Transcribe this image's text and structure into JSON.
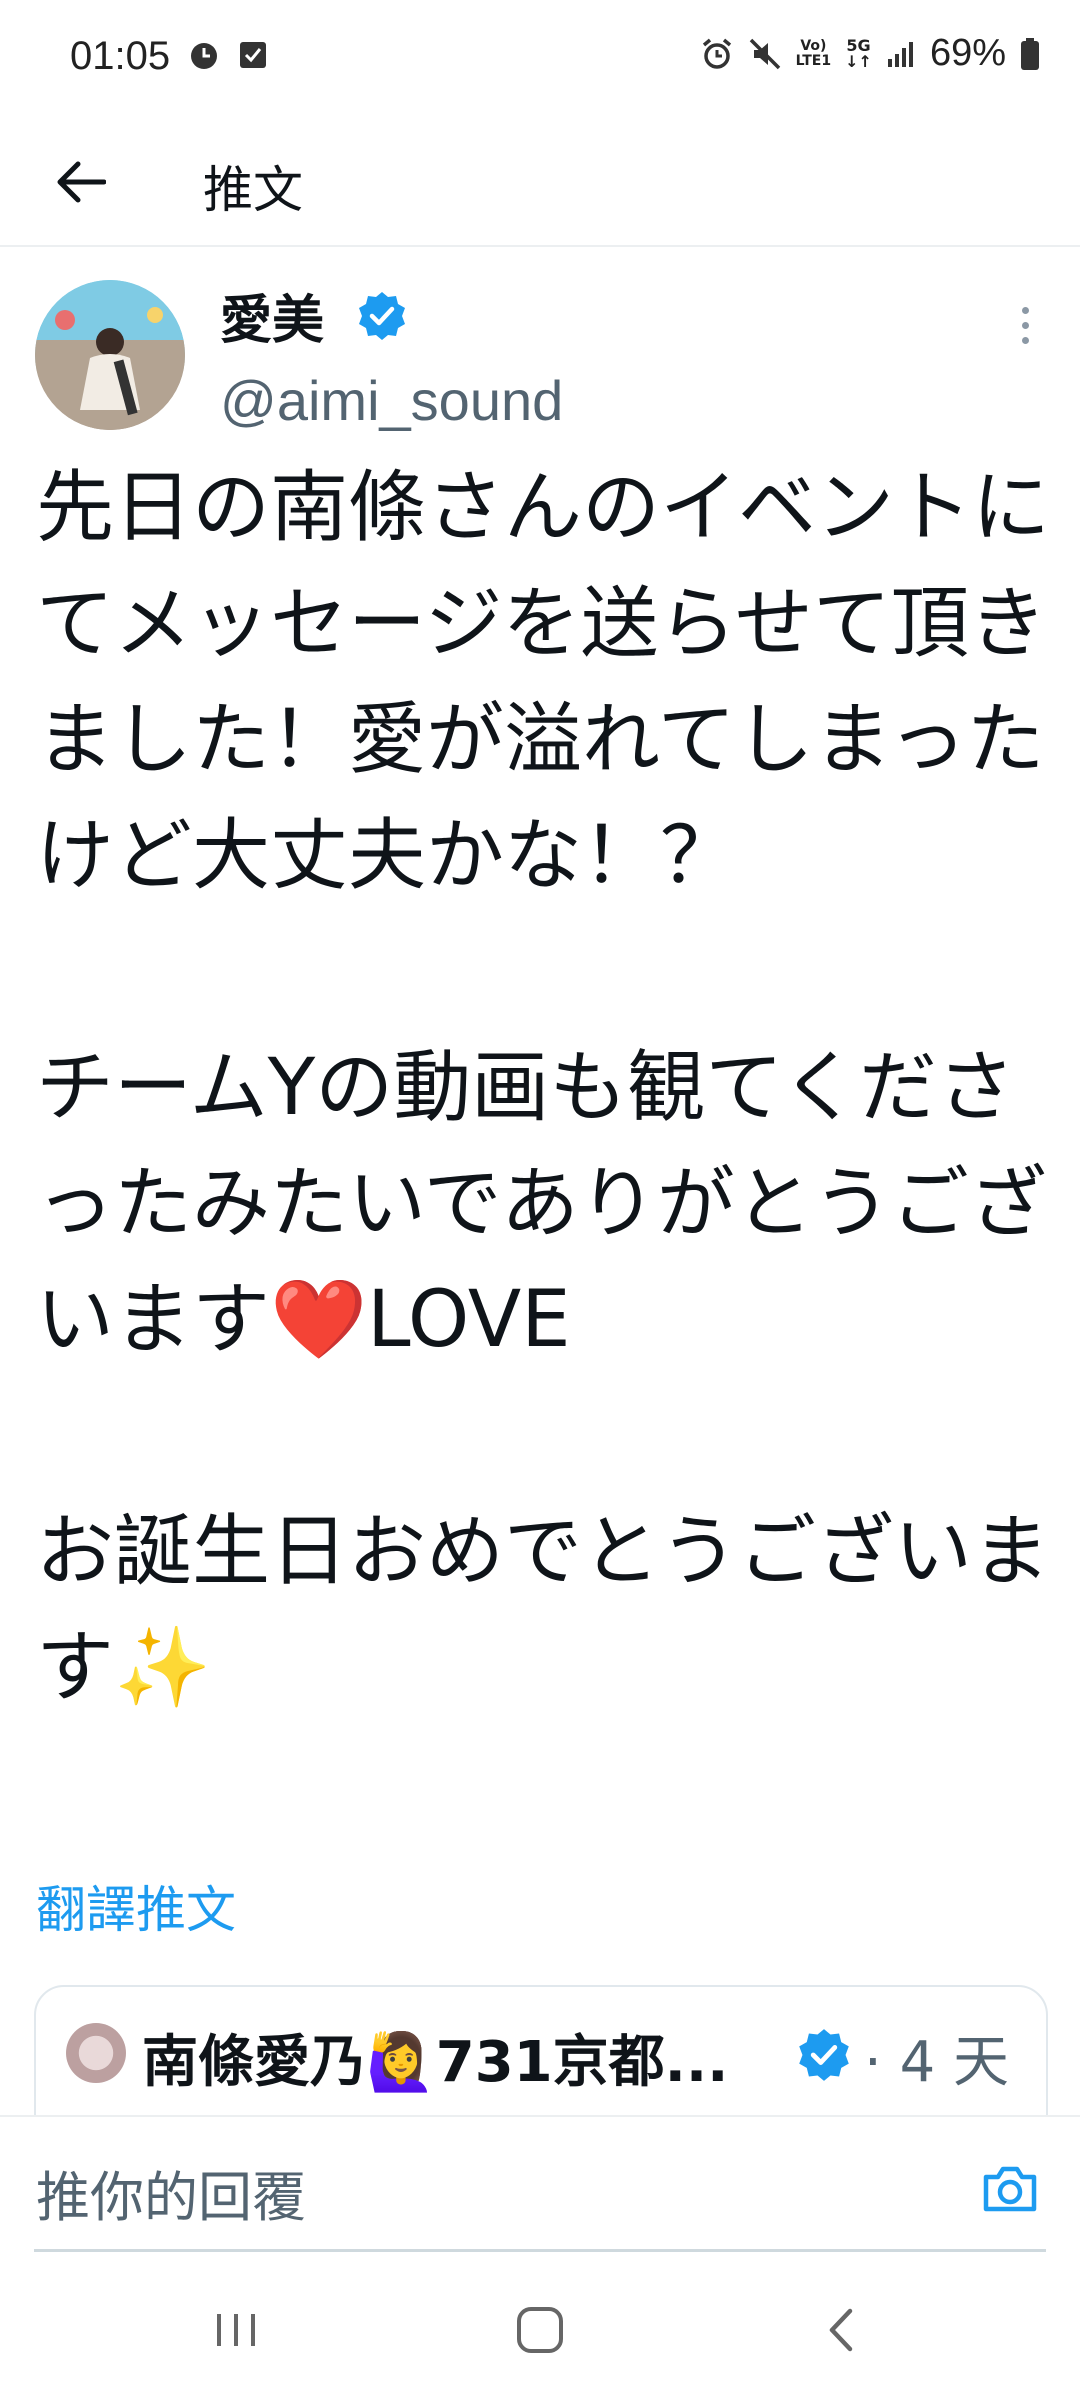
{
  "status_bar": {
    "time": "01:05",
    "battery": "69%",
    "network_volte": "Vo)\nLTE1",
    "network_5g": "5G",
    "icons": [
      "clock-icon",
      "checkbox-notification-icon",
      "alarm-icon",
      "mute-icon",
      "volte-icon",
      "5g-data-icon",
      "signal-icon",
      "battery-icon"
    ]
  },
  "header": {
    "title": "推文",
    "back_icon": "arrow-left-icon"
  },
  "tweet": {
    "author_name": "愛美",
    "handle": "@aimi_sound",
    "verified": true,
    "more_icon": "more-vertical-icon",
    "text_part1": "先日の南條さんのイベントにてメッセージを送らせて頂きました！愛が溢れてしまったけど大丈夫かな！？\n\nチームYの動画も観てくださったみたいでありがとうございます",
    "heart": "❤️",
    "text_part2": "LOVE\n\nお誕生日おめでとうございます",
    "sparkles": "✨",
    "translate_label": "翻譯推文"
  },
  "quoted_tweet": {
    "author_name": "南條愛乃🙋‍♀️731京都...",
    "verified": true,
    "time": "· 4 天"
  },
  "reply": {
    "placeholder": "推你的回覆",
    "camera_icon": "camera-icon"
  },
  "nav": {
    "recents_icon": "recents-icon",
    "home_icon": "home-icon",
    "back_icon": "back-chevron-icon"
  },
  "colors": {
    "accent": "#1d9bf0",
    "secondary_text": "#536471",
    "heart": "#dd2e44"
  }
}
